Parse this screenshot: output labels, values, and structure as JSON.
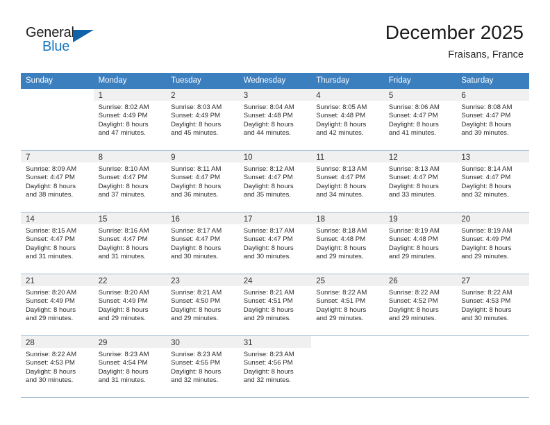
{
  "brand": {
    "name_top": "General",
    "name_bottom": "Blue",
    "triangle_color": "#1063a8",
    "blue_color": "#1878be"
  },
  "header": {
    "title": "December 2025",
    "subtitle": "Fraisans, France"
  },
  "theme": {
    "header_row_bg": "#3c7fbe",
    "day_number_band_bg": "#f0f0f0",
    "grid_line": "#9fb9d2",
    "text": "#2a2a2a"
  },
  "weekdays": [
    "Sunday",
    "Monday",
    "Tuesday",
    "Wednesday",
    "Thursday",
    "Friday",
    "Saturday"
  ],
  "weeks": [
    [
      {
        "day": "",
        "blank": true,
        "sunrise": "",
        "sunset": "",
        "daylight_line1": "",
        "daylight_line2": ""
      },
      {
        "day": "1",
        "sunrise": "Sunrise: 8:02 AM",
        "sunset": "Sunset: 4:49 PM",
        "daylight_line1": "Daylight: 8 hours",
        "daylight_line2": "and 47 minutes."
      },
      {
        "day": "2",
        "sunrise": "Sunrise: 8:03 AM",
        "sunset": "Sunset: 4:49 PM",
        "daylight_line1": "Daylight: 8 hours",
        "daylight_line2": "and 45 minutes."
      },
      {
        "day": "3",
        "sunrise": "Sunrise: 8:04 AM",
        "sunset": "Sunset: 4:48 PM",
        "daylight_line1": "Daylight: 8 hours",
        "daylight_line2": "and 44 minutes."
      },
      {
        "day": "4",
        "sunrise": "Sunrise: 8:05 AM",
        "sunset": "Sunset: 4:48 PM",
        "daylight_line1": "Daylight: 8 hours",
        "daylight_line2": "and 42 minutes."
      },
      {
        "day": "5",
        "sunrise": "Sunrise: 8:06 AM",
        "sunset": "Sunset: 4:47 PM",
        "daylight_line1": "Daylight: 8 hours",
        "daylight_line2": "and 41 minutes."
      },
      {
        "day": "6",
        "sunrise": "Sunrise: 8:08 AM",
        "sunset": "Sunset: 4:47 PM",
        "daylight_line1": "Daylight: 8 hours",
        "daylight_line2": "and 39 minutes."
      }
    ],
    [
      {
        "day": "7",
        "sunrise": "Sunrise: 8:09 AM",
        "sunset": "Sunset: 4:47 PM",
        "daylight_line1": "Daylight: 8 hours",
        "daylight_line2": "and 38 minutes."
      },
      {
        "day": "8",
        "sunrise": "Sunrise: 8:10 AM",
        "sunset": "Sunset: 4:47 PM",
        "daylight_line1": "Daylight: 8 hours",
        "daylight_line2": "and 37 minutes."
      },
      {
        "day": "9",
        "sunrise": "Sunrise: 8:11 AM",
        "sunset": "Sunset: 4:47 PM",
        "daylight_line1": "Daylight: 8 hours",
        "daylight_line2": "and 36 minutes."
      },
      {
        "day": "10",
        "sunrise": "Sunrise: 8:12 AM",
        "sunset": "Sunset: 4:47 PM",
        "daylight_line1": "Daylight: 8 hours",
        "daylight_line2": "and 35 minutes."
      },
      {
        "day": "11",
        "sunrise": "Sunrise: 8:13 AM",
        "sunset": "Sunset: 4:47 PM",
        "daylight_line1": "Daylight: 8 hours",
        "daylight_line2": "and 34 minutes."
      },
      {
        "day": "12",
        "sunrise": "Sunrise: 8:13 AM",
        "sunset": "Sunset: 4:47 PM",
        "daylight_line1": "Daylight: 8 hours",
        "daylight_line2": "and 33 minutes."
      },
      {
        "day": "13",
        "sunrise": "Sunrise: 8:14 AM",
        "sunset": "Sunset: 4:47 PM",
        "daylight_line1": "Daylight: 8 hours",
        "daylight_line2": "and 32 minutes."
      }
    ],
    [
      {
        "day": "14",
        "sunrise": "Sunrise: 8:15 AM",
        "sunset": "Sunset: 4:47 PM",
        "daylight_line1": "Daylight: 8 hours",
        "daylight_line2": "and 31 minutes."
      },
      {
        "day": "15",
        "sunrise": "Sunrise: 8:16 AM",
        "sunset": "Sunset: 4:47 PM",
        "daylight_line1": "Daylight: 8 hours",
        "daylight_line2": "and 31 minutes."
      },
      {
        "day": "16",
        "sunrise": "Sunrise: 8:17 AM",
        "sunset": "Sunset: 4:47 PM",
        "daylight_line1": "Daylight: 8 hours",
        "daylight_line2": "and 30 minutes."
      },
      {
        "day": "17",
        "sunrise": "Sunrise: 8:17 AM",
        "sunset": "Sunset: 4:47 PM",
        "daylight_line1": "Daylight: 8 hours",
        "daylight_line2": "and 30 minutes."
      },
      {
        "day": "18",
        "sunrise": "Sunrise: 8:18 AM",
        "sunset": "Sunset: 4:48 PM",
        "daylight_line1": "Daylight: 8 hours",
        "daylight_line2": "and 29 minutes."
      },
      {
        "day": "19",
        "sunrise": "Sunrise: 8:19 AM",
        "sunset": "Sunset: 4:48 PM",
        "daylight_line1": "Daylight: 8 hours",
        "daylight_line2": "and 29 minutes."
      },
      {
        "day": "20",
        "sunrise": "Sunrise: 8:19 AM",
        "sunset": "Sunset: 4:49 PM",
        "daylight_line1": "Daylight: 8 hours",
        "daylight_line2": "and 29 minutes."
      }
    ],
    [
      {
        "day": "21",
        "sunrise": "Sunrise: 8:20 AM",
        "sunset": "Sunset: 4:49 PM",
        "daylight_line1": "Daylight: 8 hours",
        "daylight_line2": "and 29 minutes."
      },
      {
        "day": "22",
        "sunrise": "Sunrise: 8:20 AM",
        "sunset": "Sunset: 4:49 PM",
        "daylight_line1": "Daylight: 8 hours",
        "daylight_line2": "and 29 minutes."
      },
      {
        "day": "23",
        "sunrise": "Sunrise: 8:21 AM",
        "sunset": "Sunset: 4:50 PM",
        "daylight_line1": "Daylight: 8 hours",
        "daylight_line2": "and 29 minutes."
      },
      {
        "day": "24",
        "sunrise": "Sunrise: 8:21 AM",
        "sunset": "Sunset: 4:51 PM",
        "daylight_line1": "Daylight: 8 hours",
        "daylight_line2": "and 29 minutes."
      },
      {
        "day": "25",
        "sunrise": "Sunrise: 8:22 AM",
        "sunset": "Sunset: 4:51 PM",
        "daylight_line1": "Daylight: 8 hours",
        "daylight_line2": "and 29 minutes."
      },
      {
        "day": "26",
        "sunrise": "Sunrise: 8:22 AM",
        "sunset": "Sunset: 4:52 PM",
        "daylight_line1": "Daylight: 8 hours",
        "daylight_line2": "and 29 minutes."
      },
      {
        "day": "27",
        "sunrise": "Sunrise: 8:22 AM",
        "sunset": "Sunset: 4:53 PM",
        "daylight_line1": "Daylight: 8 hours",
        "daylight_line2": "and 30 minutes."
      }
    ],
    [
      {
        "day": "28",
        "sunrise": "Sunrise: 8:22 AM",
        "sunset": "Sunset: 4:53 PM",
        "daylight_line1": "Daylight: 8 hours",
        "daylight_line2": "and 30 minutes."
      },
      {
        "day": "29",
        "sunrise": "Sunrise: 8:23 AM",
        "sunset": "Sunset: 4:54 PM",
        "daylight_line1": "Daylight: 8 hours",
        "daylight_line2": "and 31 minutes."
      },
      {
        "day": "30",
        "sunrise": "Sunrise: 8:23 AM",
        "sunset": "Sunset: 4:55 PM",
        "daylight_line1": "Daylight: 8 hours",
        "daylight_line2": "and 32 minutes."
      },
      {
        "day": "31",
        "sunrise": "Sunrise: 8:23 AM",
        "sunset": "Sunset: 4:56 PM",
        "daylight_line1": "Daylight: 8 hours",
        "daylight_line2": "and 32 minutes."
      },
      {
        "day": "",
        "blank": true,
        "sunrise": "",
        "sunset": "",
        "daylight_line1": "",
        "daylight_line2": ""
      },
      {
        "day": "",
        "blank": true,
        "sunrise": "",
        "sunset": "",
        "daylight_line1": "",
        "daylight_line2": ""
      },
      {
        "day": "",
        "blank": true,
        "sunrise": "",
        "sunset": "",
        "daylight_line1": "",
        "daylight_line2": ""
      }
    ]
  ]
}
